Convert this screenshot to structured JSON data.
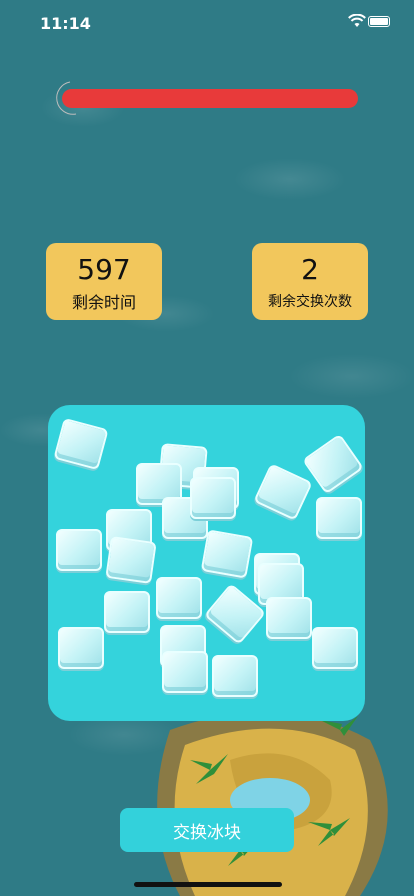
{
  "status_bar": {
    "time": "11:14",
    "icons": [
      "wifi-icon",
      "battery-icon"
    ]
  },
  "timer_bar": {
    "remaining_fraction": 1.0,
    "color": "#e83a3a",
    "icon": "moon-icon"
  },
  "stats": {
    "time_left": {
      "value": "597",
      "label": "剩余时间"
    },
    "swaps_left": {
      "value": "2",
      "label": "剩余交换次数"
    }
  },
  "board": {
    "color": "#34d3dc",
    "ice_count": 24
  },
  "actions": {
    "swap_label": "交换冰块"
  },
  "colors": {
    "card": "#f2c75c",
    "button": "#33d1db",
    "water": "#2f7b86"
  }
}
